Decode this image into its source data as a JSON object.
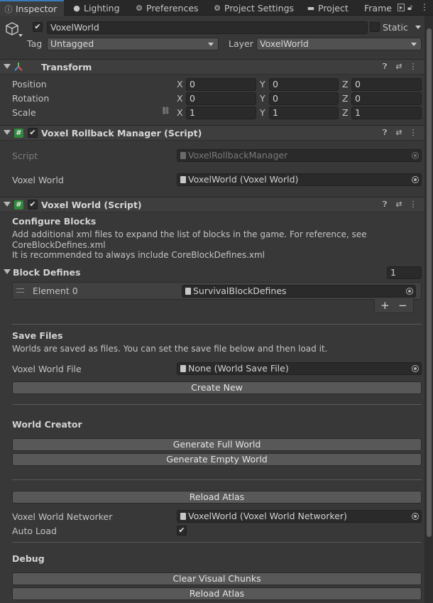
{
  "tabs": [
    {
      "label": "Inspector",
      "icon": "info-icon"
    },
    {
      "label": "Lighting",
      "icon": "lightbulb-icon"
    },
    {
      "label": "Preferences",
      "icon": "gear-icon"
    },
    {
      "label": "Project Settings",
      "icon": "gear-icon"
    },
    {
      "label": "Project",
      "icon": "folder-icon"
    },
    {
      "label": "Frame D",
      "icon": ""
    }
  ],
  "object": {
    "name": "VoxelWorld",
    "static_label": "Static",
    "tag_label": "Tag",
    "tag_value": "Untagged",
    "layer_label": "Layer",
    "layer_value": "VoxelWorld"
  },
  "transform": {
    "title": "Transform",
    "rows": [
      {
        "label": "Position",
        "x": "0",
        "y": "0",
        "z": "0"
      },
      {
        "label": "Rotation",
        "x": "0",
        "y": "0",
        "z": "0"
      },
      {
        "label": "Scale",
        "x": "1",
        "y": "1",
        "z": "1"
      }
    ],
    "axis": {
      "x": "X",
      "y": "Y",
      "z": "Z"
    }
  },
  "rollback": {
    "title": "Voxel Rollback Manager (Script)",
    "script_label": "Script",
    "script_value": "VoxelRollbackManager",
    "world_label": "Voxel World",
    "world_value": "VoxelWorld (Voxel World)"
  },
  "voxelworld": {
    "title": "Voxel World (Script)",
    "configure_heading": "Configure Blocks",
    "configure_text1": "Add additional xml files to expand the list of blocks in the game. For reference, see",
    "configure_text2": "CoreBlockDefines.xml",
    "configure_text3": "It is recommended to always include CoreBlockDefines.xml",
    "block_defines_label": "Block Defines",
    "block_defines_count": "1",
    "element_label": "Element 0",
    "element_value": "SurvivalBlockDefines",
    "plus": "+",
    "minus": "−",
    "save_heading": "Save Files",
    "save_text": "Worlds are saved as files. You can set the save file below and then load it.",
    "save_file_label": "Voxel World File",
    "save_file_value": "None (World Save File)",
    "create_new": "Create New",
    "creator_heading": "World Creator",
    "gen_full": "Generate Full World",
    "gen_empty": "Generate Empty World",
    "reload_atlas": "Reload Atlas",
    "networker_label": "Voxel World Networker",
    "networker_value": "VoxelWorld (Voxel World Networker)",
    "autoload_label": "Auto Load",
    "debug_heading": "Debug",
    "clear_chunks": "Clear Visual Chunks",
    "reload_atlas2": "Reload Atlas"
  }
}
